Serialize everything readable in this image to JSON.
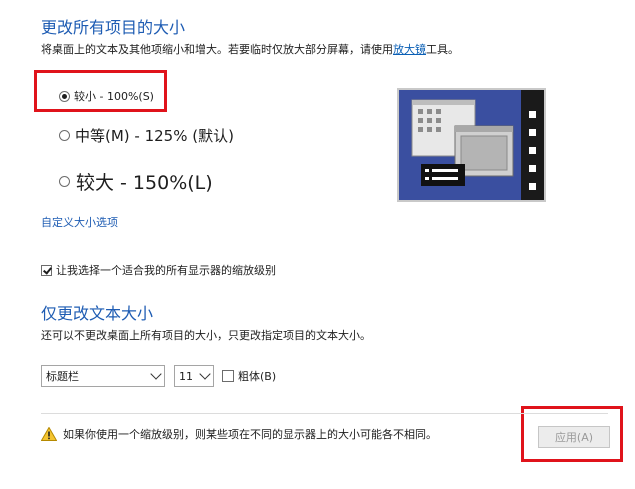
{
  "heading_all": "更改所有项目的大小",
  "desc_all_prefix": "将桌面上的文本及其他项缩小和增大。若要临时仅放大部分屏幕，请使用",
  "desc_all_link": "放大镜",
  "desc_all_suffix": "工具。",
  "size_options": [
    {
      "label": "较小 - 100%(S)",
      "checked": true
    },
    {
      "label": "中等(M) - 125% (默认)",
      "checked": false
    },
    {
      "label": "较大 - 150%(L)",
      "checked": false
    }
  ],
  "custom_size_link": "自定义大小选项",
  "scale_checkbox_label": "让我选择一个适合我的所有显示器的缩放级别",
  "heading_text": "仅更改文本大小",
  "desc_text": "还可以不更改桌面上所有项目的大小，只更改指定项目的文本大小。",
  "item_select_value": "标题栏",
  "font_size_value": "11",
  "bold_label": "粗体(B)",
  "warning_text": "如果你使用一个缩放级别，则某些项在不同的显示器上的大小可能各不相同。",
  "apply_label": "应用(A)",
  "colors": {
    "heading": "#1e5cb3",
    "link": "#0a5fb5",
    "highlight_box": "#e0131b",
    "preview_bg": "#3a4fa0"
  }
}
